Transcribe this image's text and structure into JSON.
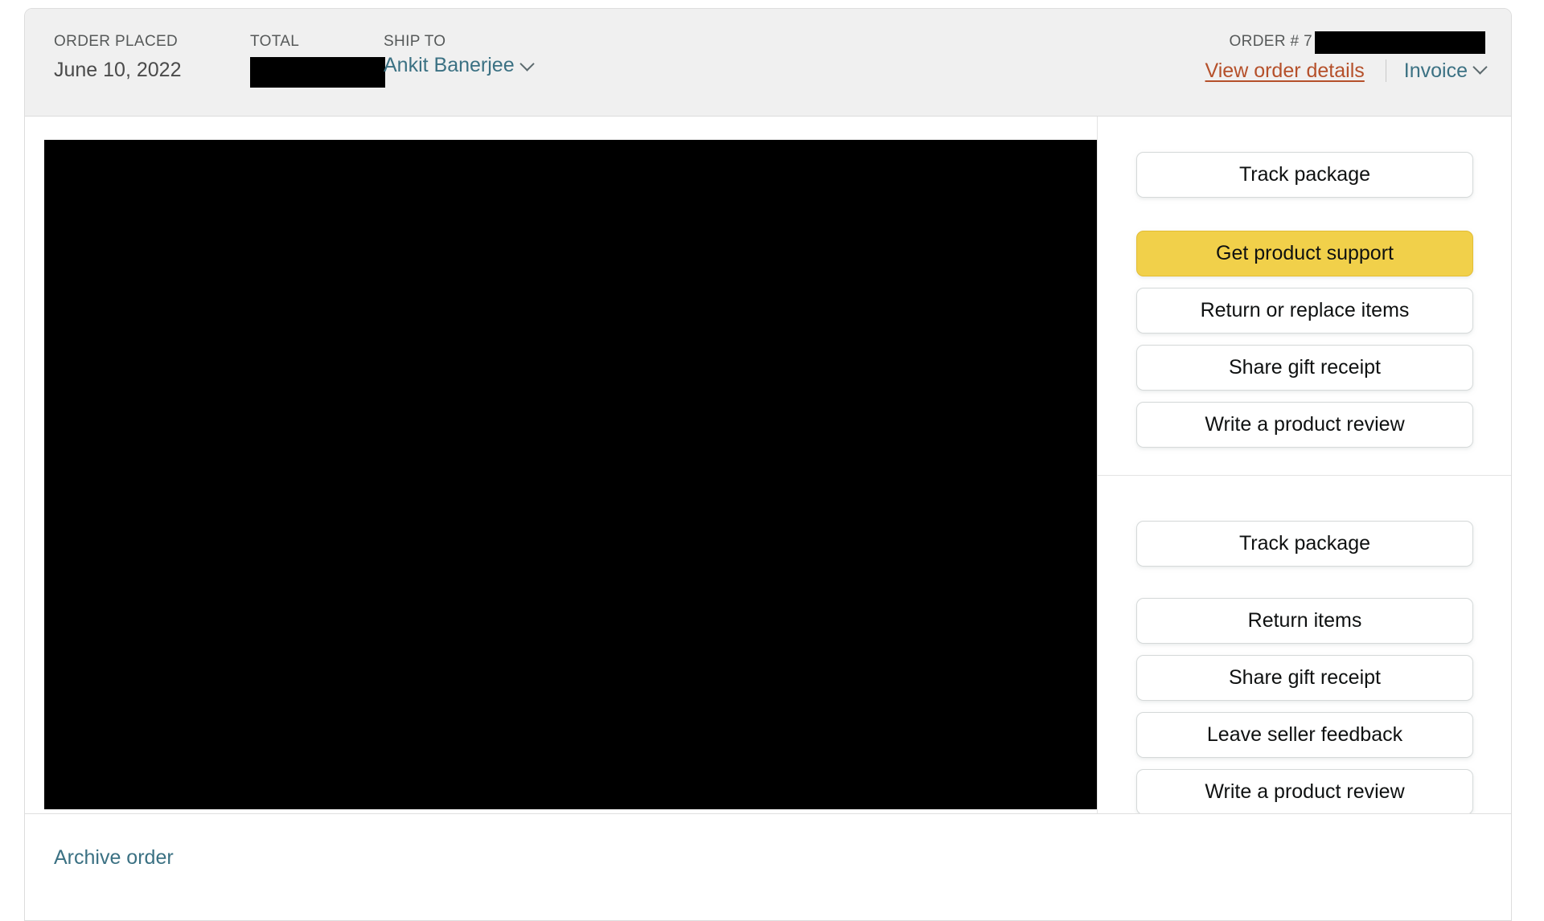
{
  "header": {
    "order_placed_label": "ORDER PLACED",
    "order_placed_value": "June 10, 2022",
    "total_label": "TOTAL",
    "total_value_redacted": "",
    "ship_to_label": "SHIP TO",
    "ship_to_value": "Ankit Banerjee",
    "order_number_label": "ORDER # 7",
    "order_number_redacted": "",
    "view_order_details_label": "View order details",
    "invoice_label": "Invoice",
    "ship_to_chevron_icon": "chevron-down-icon",
    "invoice_chevron_icon": "chevron-down-icon"
  },
  "content": {
    "redacted_region": ""
  },
  "actions_primary": [
    {
      "label": "Track package",
      "style": "secondary"
    },
    {
      "label": "Get product support",
      "style": "primary"
    },
    {
      "label": "Return or replace items",
      "style": "secondary"
    },
    {
      "label": "Share gift receipt",
      "style": "secondary"
    },
    {
      "label": "Write a product review",
      "style": "secondary"
    }
  ],
  "actions_secondary": [
    {
      "label": "Track package",
      "style": "secondary"
    },
    {
      "label": "Return items",
      "style": "secondary"
    },
    {
      "label": "Share gift receipt",
      "style": "secondary"
    },
    {
      "label": "Leave seller feedback",
      "style": "secondary"
    },
    {
      "label": "Write a product review",
      "style": "secondary"
    }
  ],
  "footer": {
    "archive_order_label": "Archive order"
  },
  "colors": {
    "header_bg": "#f0f0f0",
    "card_border": "#dddddd",
    "link_teal": "#3b7183",
    "link_orange": "#b5502a",
    "primary_button_bg": "#f1d04a",
    "button_border": "#d5d9d9",
    "redaction": "#000000",
    "text_muted": "#565959",
    "text_dark": "#0f1111"
  }
}
